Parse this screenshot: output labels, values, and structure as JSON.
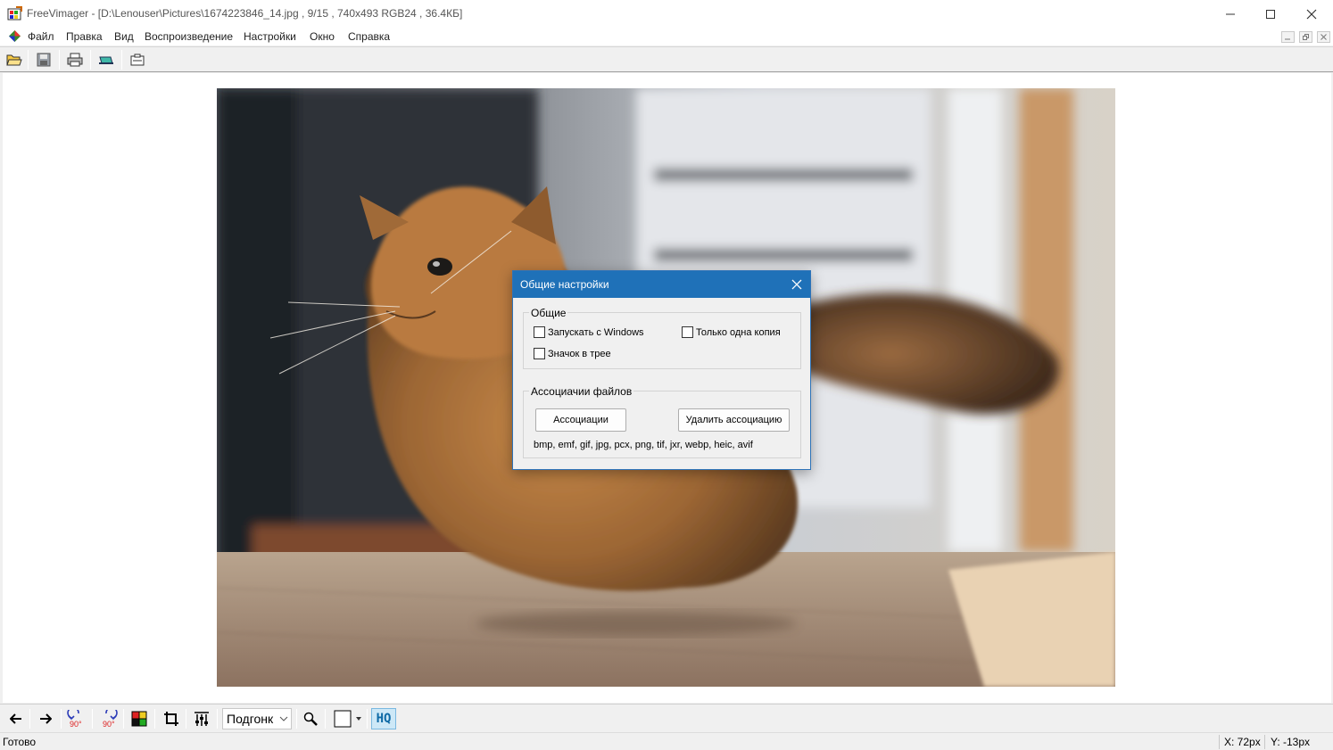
{
  "window": {
    "title": "FreeVimager - [D:\\Lenouser\\Pictures\\1674223846_14.jpg , 9/15 , 740x493 RGB24 , 36.4КБ]",
    "controls": [
      "minimize-icon",
      "maximize-icon",
      "close-icon"
    ]
  },
  "menu": {
    "items": [
      "Файл",
      "Правка",
      "Вид",
      "Воспроизведение",
      "Настройки",
      "Окно",
      "Справка"
    ]
  },
  "toolbar": {
    "icons": [
      "open-folder-icon",
      "save-icon",
      "print-icon",
      "send-email-icon",
      "capture-icon"
    ]
  },
  "bottom_toolbar": {
    "icons": [
      "arrow-left-icon",
      "arrow-right-icon",
      "rotate-ccw-90-icon",
      "rotate-cw-90-icon",
      "color-adjust-icon",
      "crop-icon",
      "levels-icon",
      "zoom-icon",
      "background-color-icon",
      "hq-icon"
    ],
    "rotate_label": "90°",
    "zoom_value": "Подгонк",
    "hq_label": "HQ"
  },
  "status": {
    "text": "Готово",
    "x": "X: 72px",
    "y": "Y: -13px"
  },
  "dialog": {
    "title": "Общие настройки",
    "general_group": "Общие",
    "checkbox_startup": "Запускать с Windows",
    "checkbox_single": "Только одна копия",
    "checkbox_tray": "Значок в трее",
    "assoc_group": "Ассоциачии файлов",
    "assoc_button": "Ассоциации",
    "remove_button": "Удалить ассоциацию",
    "extensions": "bmp, emf, gif, jpg, pcx, png, tif, jxr, webp, heic, avif"
  },
  "colors": {
    "dialog_title_bg": "#1f71b8",
    "hq_active_bg": "#cde8f7"
  }
}
